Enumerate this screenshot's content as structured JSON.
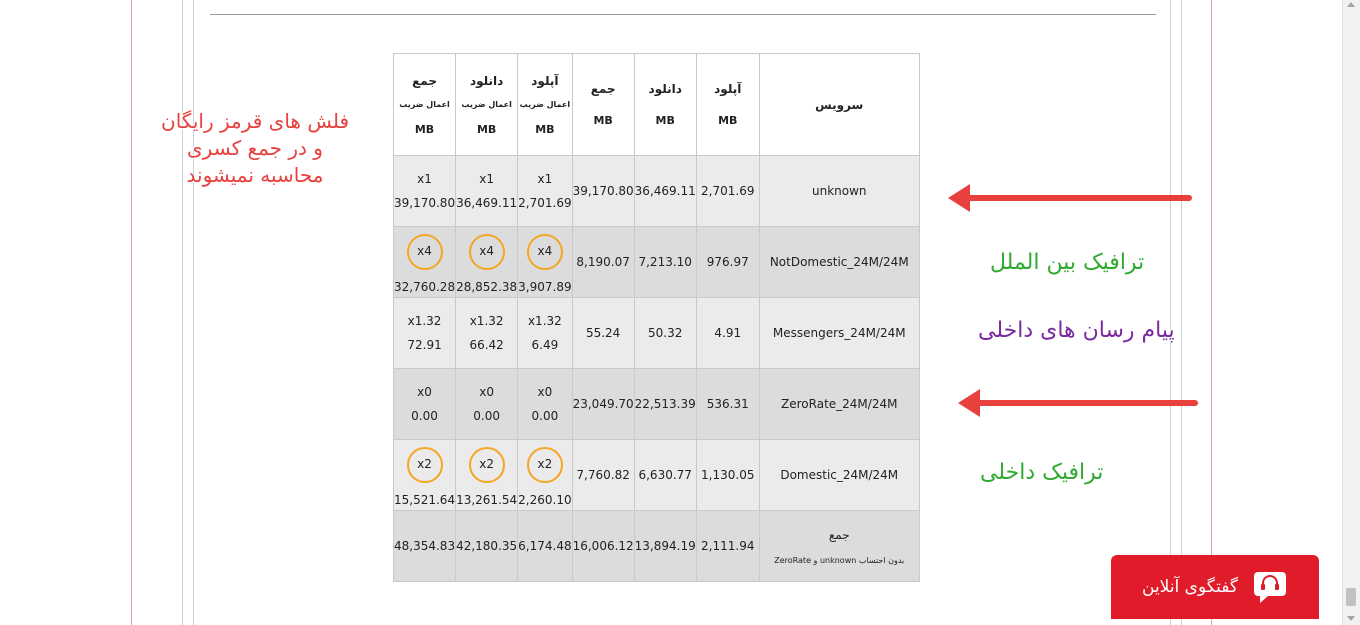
{
  "table": {
    "headers": {
      "service": "سرویس",
      "upload": "آپلود",
      "download": "دانلود",
      "total": "جمع",
      "unit": "MB",
      "with_multiplier": "اعمال ضریب"
    },
    "rows": [
      {
        "service": "unknown",
        "upload": "2,701.69",
        "download": "36,469.11",
        "total": "39,170.80",
        "m_upload_x": "x1",
        "m_upload": "2,701.69",
        "m_download_x": "x1",
        "m_download": "36,469.11",
        "m_total_x": "x1",
        "m_total": "39,170.80",
        "circled": false
      },
      {
        "service": "NotDomestic_24M/24M",
        "upload": "976.97",
        "download": "7,213.10",
        "total": "8,190.07",
        "m_upload_x": "x4",
        "m_upload": "3,907.89",
        "m_download_x": "x4",
        "m_download": "28,852.38",
        "m_total_x": "x4",
        "m_total": "32,760.28",
        "circled": true
      },
      {
        "service": "Messengers_24M/24M",
        "upload": "4.91",
        "download": "50.32",
        "total": "55.24",
        "m_upload_x": "x1.32",
        "m_upload": "6.49",
        "m_download_x": "x1.32",
        "m_download": "66.42",
        "m_total_x": "x1.32",
        "m_total": "72.91",
        "circled": false
      },
      {
        "service": "ZeroRate_24M/24M",
        "upload": "536.31",
        "download": "22,513.39",
        "total": "23,049.70",
        "m_upload_x": "x0",
        "m_upload": "0.00",
        "m_download_x": "x0",
        "m_download": "0.00",
        "m_total_x": "x0",
        "m_total": "0.00",
        "circled": false
      },
      {
        "service": "Domestic_24M/24M",
        "upload": "1,130.05",
        "download": "6,630.77",
        "total": "7,760.82",
        "m_upload_x": "x2",
        "m_upload": "2,260.10",
        "m_download_x": "x2",
        "m_download": "13,261.54",
        "m_total_x": "x2",
        "m_total": "15,521.64",
        "circled": true
      }
    ],
    "totals": {
      "label": "جمع",
      "note": "بدون احتساب unknown و ZeroRate",
      "upload": "2,111.94",
      "download": "13,894.19",
      "total": "16,006.12",
      "m_upload": "6,174.48",
      "m_download": "42,180.35",
      "m_total": "48,354.83"
    }
  },
  "annotations": {
    "red_note_line1": "فلش های قرمز رایگان",
    "red_note_line2": "و در جمع کسری",
    "red_note_line3": "محاسبه نمیشوند",
    "international": "ترافیک بین الملل",
    "messengers": "پیام رسان های داخلی",
    "domestic": "ترافیک داخلی"
  },
  "chat": {
    "label": "گفتگوی آنلاین",
    "icon": "headset-chat-icon",
    "color": "#e11c2a"
  },
  "colors": {
    "arrow_red": "#e8403c",
    "circle_orange": "#f5a623",
    "green": "#2faa2f",
    "purple": "#7a2aa0"
  }
}
